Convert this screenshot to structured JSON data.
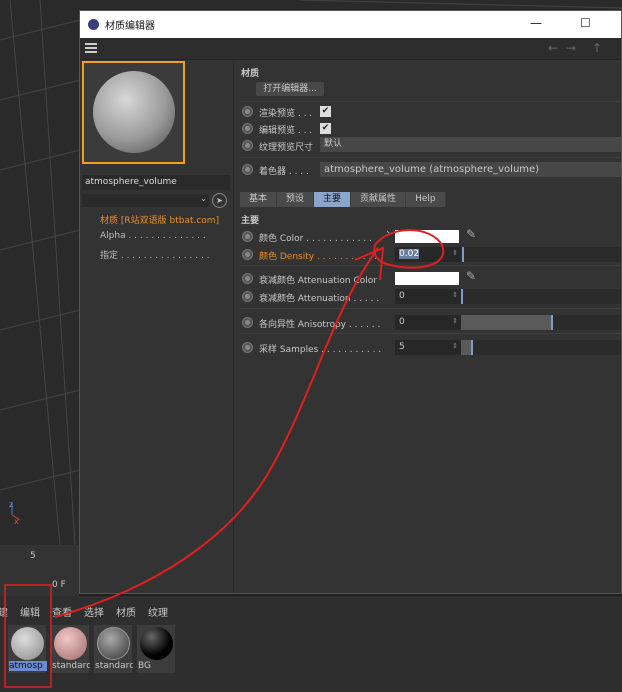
{
  "window": {
    "title": "材质编辑器",
    "minimize": "—",
    "maximize": "☐"
  },
  "left": {
    "material_name": "atmosphere_volume",
    "channels": [
      "材质 [R站双语版 btbat.com]",
      "Alpha . . . . . . . . . . . . . .",
      "指定 . . . . . . . . . . . . . . . ."
    ]
  },
  "right": {
    "section_material": "材质",
    "open_editor": "打开编辑器...",
    "render_preview": "渲染预览 . . .",
    "editor_preview": "编辑预览 . . .",
    "texture_preview_size": "纹理预览尺寸",
    "texture_preview_value": "默认",
    "shader_label": "着色器 . . . .",
    "shader_value": "atmosphere_volume (atmosphere_volume)",
    "tabs": [
      "基本",
      "预设",
      "主要",
      "贡献属性",
      "Help"
    ],
    "section_main": "主要",
    "params": [
      {
        "label": "颜色 Color . . . . . . . . . . . .",
        "type": "color"
      },
      {
        "label": "颜色 Density . . . . . . . . . . . .",
        "value": "0.02",
        "slider": 0.0
      },
      {
        "label": "衰减颜色 Attenuation Color",
        "type": "color"
      },
      {
        "label": "衰减颜色 Attenuation . . . . .",
        "value": "0",
        "slider": 0.0
      },
      {
        "label": "各向异性 Anisotropy . . . . . .",
        "value": "0",
        "slider": 0.5
      },
      {
        "label": "采样 Samples . . . . . . . . . . .",
        "value": "5",
        "slider": 0.05
      }
    ]
  },
  "timeline": {
    "frame": "5",
    "field": "0 F"
  },
  "bottom": {
    "menu": [
      "建",
      "编辑",
      "查看",
      "选择",
      "材质",
      "纹理"
    ],
    "materials": [
      "atmosp",
      "standard",
      "standard",
      "BG"
    ]
  },
  "colors": {
    "accent": "#e8902a",
    "tab_active": "#8aa6cc",
    "annotation": "#e02020"
  }
}
